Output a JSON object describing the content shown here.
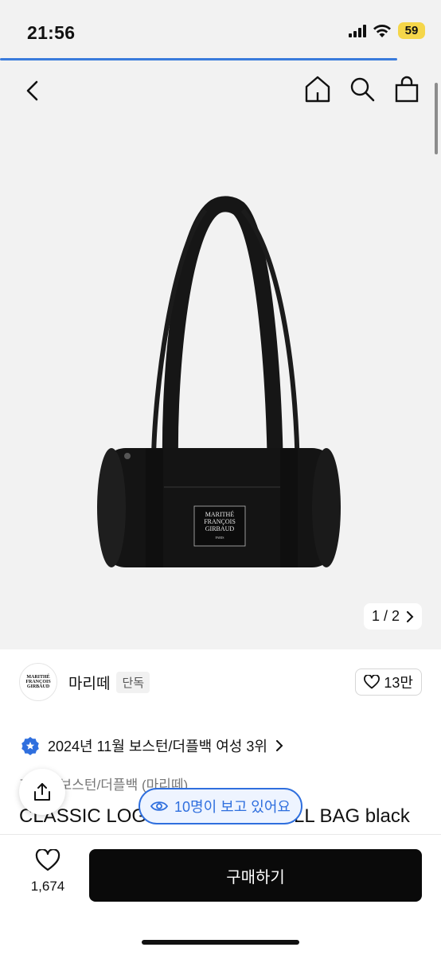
{
  "status": {
    "time": "21:56",
    "battery": "59"
  },
  "scroll_progress_fraction": 0.9,
  "nav": {
    "icons": [
      "back-arrow-icon",
      "home-icon",
      "search-icon",
      "shopping-bag-icon"
    ]
  },
  "product": {
    "label_lines": [
      "MARITHÉ",
      "FRANÇOIS",
      "GIRBAUD",
      "PARIS"
    ],
    "page_indicator": "1 / 2",
    "brand": {
      "name": "마리떼",
      "tag": "단독",
      "likes": "13만"
    },
    "ranking": "2024년 11월 보스턴/더플백 여성 3위",
    "category": "가방 > 보스턴/더플백 (마리떼)",
    "title": "CLASSIC LOGO BOSTON SMALL BAG black",
    "viewers": "10명이 보고 있어요"
  },
  "bottom_bar": {
    "wish_count": "1,674",
    "buy_label": "구매하기"
  },
  "colors": {
    "accent": "#2f6fde",
    "battery": "#f5d64a",
    "buy_button": "#0a0a0a"
  }
}
